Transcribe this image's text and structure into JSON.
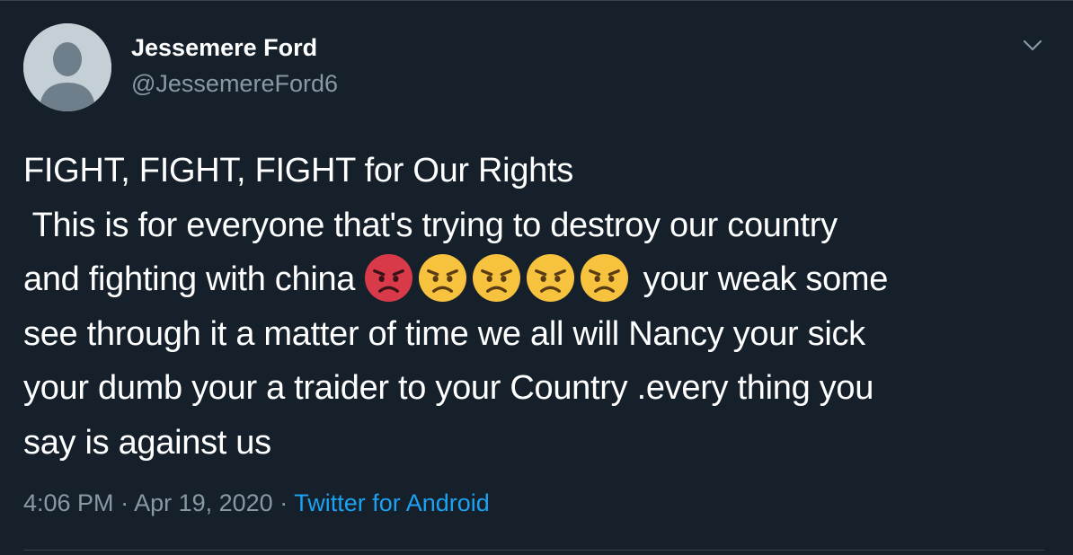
{
  "user": {
    "display_name": "Jessemere Ford",
    "handle": "@JessemereFord6",
    "avatar_icon": "default-avatar-icon"
  },
  "menu_icon": "chevron-down-icon",
  "tweet": {
    "line1": "FIGHT, FIGHT, FIGHT  for Our Rights",
    "line2": " This is for everyone that's trying to destroy our country",
    "line3_before_emoji": "and fighting with china ",
    "emojis": [
      "pouting-face-emoji",
      "angry-face-emoji",
      "angry-face-emoji",
      "angry-face-emoji",
      "angry-face-emoji"
    ],
    "line3_after_emoji": " your weak some",
    "line4": "see through it a matter of time we all will Nancy your sick",
    "line5": "your dumb your a traider to your Country .every thing you",
    "line6": "say is against us"
  },
  "meta": {
    "time": "4:06 PM",
    "sep1": " · ",
    "date": "Apr 19, 2020",
    "sep2": " · ",
    "source": "Twitter for Android"
  },
  "colors": {
    "background": "#15202b",
    "secondary_text": "#8899a6",
    "link": "#1da1f2",
    "divider": "#38444d"
  }
}
